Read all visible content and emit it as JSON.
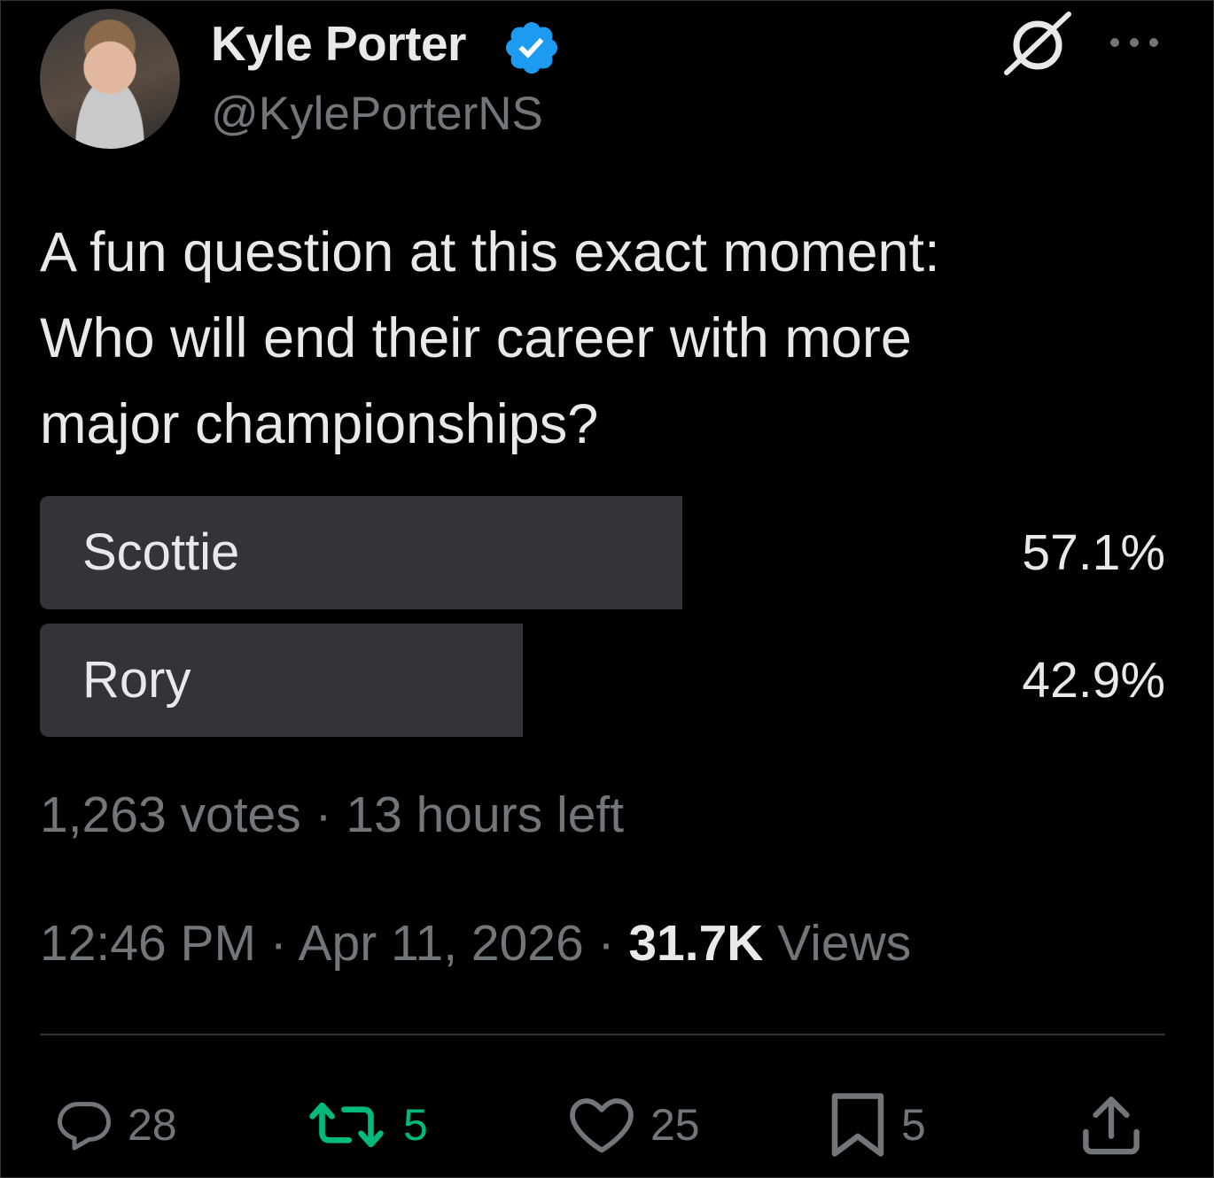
{
  "author": {
    "name": "Kyle Porter",
    "handle": "@KylePorterNS",
    "verified": true,
    "verified_color": "#1d9bf0"
  },
  "header_icons": [
    "grok-icon",
    "more-icon"
  ],
  "tweet": {
    "lines": [
      "A fun question at this exact moment:",
      "Who will end their career with more",
      "major championships?"
    ]
  },
  "poll": {
    "options": [
      {
        "label": "Scottie",
        "percent_text": "57.1%",
        "percent": 57.1
      },
      {
        "label": "Rory",
        "percent_text": "42.9%",
        "percent": 42.9
      }
    ],
    "meta": "1,263 votes · 13 hours left"
  },
  "timestamp": {
    "time_date": "12:46 PM · Apr 11, 2026 · ",
    "views_count": "31.7K",
    "views_label": " Views"
  },
  "actions": {
    "reply_count": "28",
    "retweet_count": "5",
    "like_count": "25",
    "bookmark_count": "5",
    "retweet_color": "#00ba7c"
  }
}
